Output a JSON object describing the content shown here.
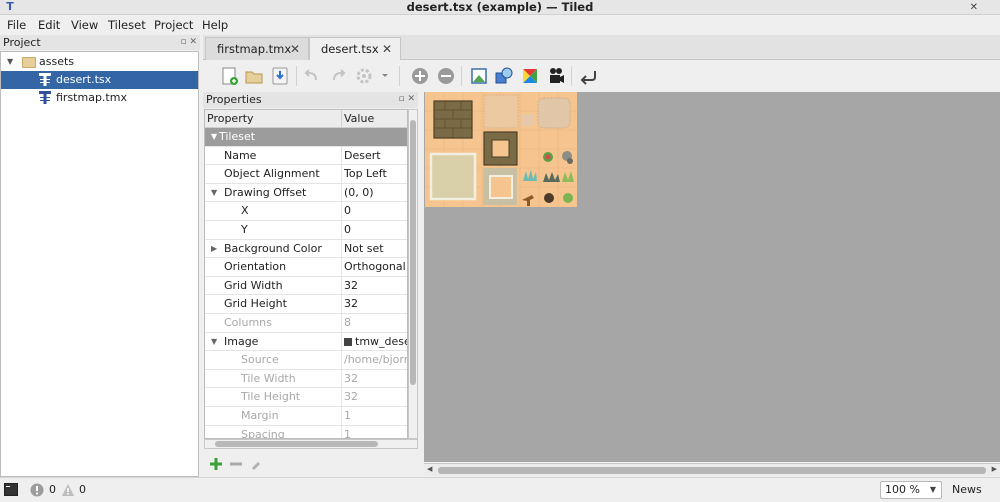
{
  "window": {
    "title": "desert.tsx (example) — Tiled",
    "close_glyph": "✕"
  },
  "menu": [
    "File",
    "Edit",
    "View",
    "Tileset",
    "Project",
    "Help"
  ],
  "project": {
    "title": "Project",
    "items": [
      {
        "label": "assets",
        "type": "folder",
        "expanded": true
      },
      {
        "label": "desert.tsx",
        "type": "tileset",
        "selected": true
      },
      {
        "label": "firstmap.tmx",
        "type": "map",
        "selected": false
      }
    ]
  },
  "tabs": [
    {
      "label": "firstmap.tmx",
      "active": false
    },
    {
      "label": "desert.tsx",
      "active": true
    }
  ],
  "toolbar": {
    "icons": [
      "new-tileset-icon",
      "open-icon",
      "save-icon",
      "undo-icon",
      "redo-icon",
      "settings-icon",
      "add-tiles-icon",
      "remove-tiles-icon",
      "edit-terrain-icon",
      "edit-collision-icon",
      "wang-sets-icon",
      "animation-icon",
      "back-icon"
    ]
  },
  "properties": {
    "title": "Properties",
    "columns": [
      "Property",
      "Value"
    ],
    "rows": [
      {
        "name": "Tileset",
        "value": "",
        "kind": "section"
      },
      {
        "name": "Name",
        "value": "Desert",
        "kind": "normal"
      },
      {
        "name": "Object Alignment",
        "value": "Top Left",
        "kind": "normal"
      },
      {
        "name": "Drawing Offset",
        "value": "(0, 0)",
        "kind": "expanded"
      },
      {
        "name": "X",
        "value": "0",
        "kind": "child"
      },
      {
        "name": "Y",
        "value": "0",
        "kind": "child"
      },
      {
        "name": "Background Color",
        "value": "Not set",
        "kind": "collapsed"
      },
      {
        "name": "Orientation",
        "value": "Orthogonal",
        "kind": "normal"
      },
      {
        "name": "Grid Width",
        "value": "32",
        "kind": "normal"
      },
      {
        "name": "Grid Height",
        "value": "32",
        "kind": "normal"
      },
      {
        "name": "Columns",
        "value": "8",
        "kind": "dim"
      },
      {
        "name": "Image",
        "value": "tmw_desert",
        "kind": "expanded"
      },
      {
        "name": "Source",
        "value": "/home/bjorn/",
        "kind": "dimchild"
      },
      {
        "name": "Tile Width",
        "value": "32",
        "kind": "dimchild"
      },
      {
        "name": "Tile Height",
        "value": "32",
        "kind": "dimchild"
      },
      {
        "name": "Margin",
        "value": "1",
        "kind": "dimchild"
      },
      {
        "name": "Spacing",
        "value": "1",
        "kind": "dimchild"
      }
    ]
  },
  "status": {
    "errors": "0",
    "warnings": "0",
    "zoom": "100 %",
    "news": "News"
  },
  "colors": {
    "selection": "#3465a4",
    "section_header": "#9c9c9c",
    "canvas_bg": "#a6a6a6",
    "sand": "#f6c48e"
  }
}
